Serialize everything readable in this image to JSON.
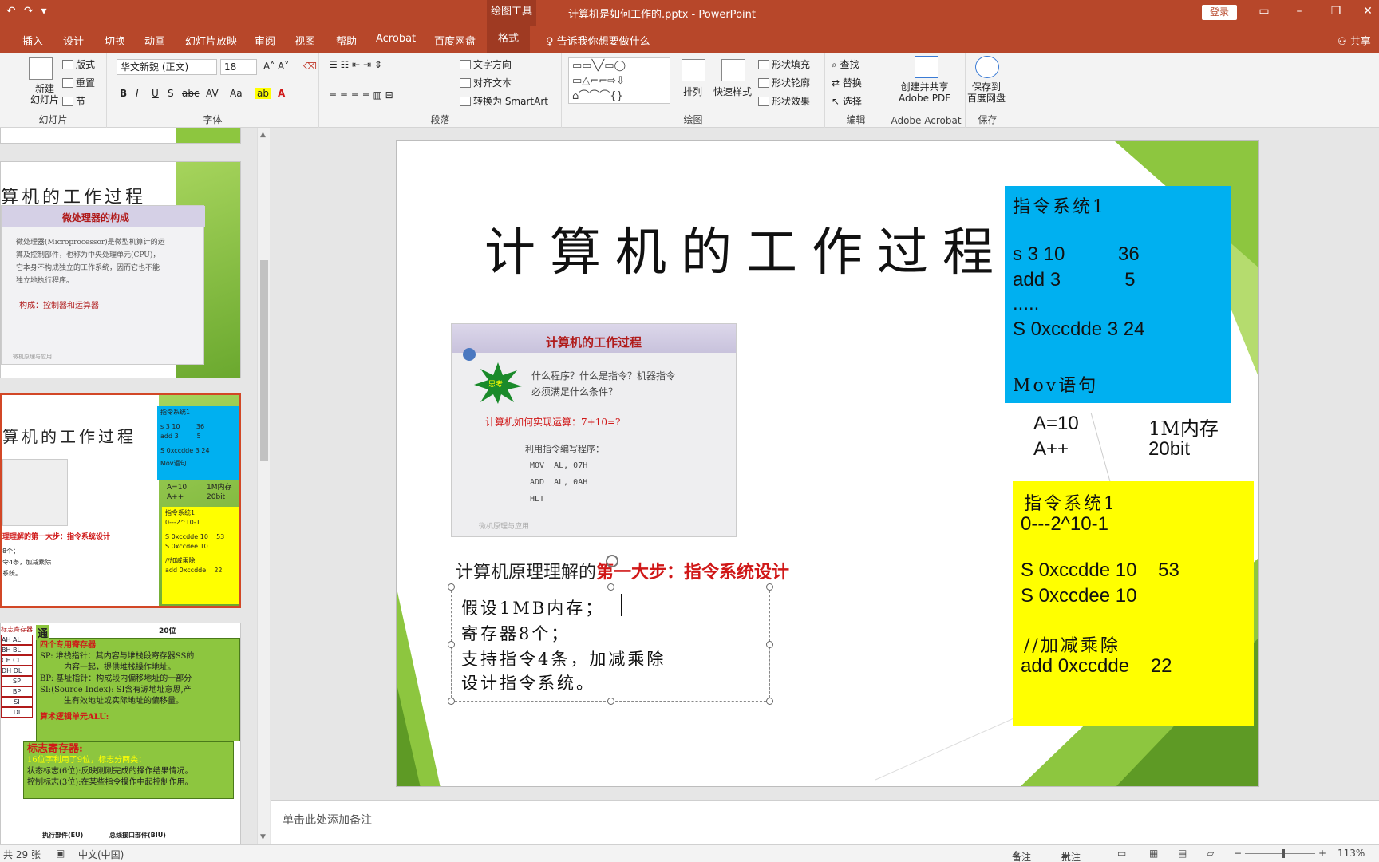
{
  "app": {
    "context_tools": "绘图工具",
    "document_title": "计算机是如何工作的.pptx - PowerPoint",
    "login_label": "登录"
  },
  "ribbon_tabs": [
    "插入",
    "设计",
    "切换",
    "动画",
    "幻灯片放映",
    "审阅",
    "视图",
    "帮助",
    "Acrobat",
    "百度网盘",
    "格式"
  ],
  "active_tab": "格式",
  "tell_me": "告诉我你想要做什么",
  "share_label": "共享",
  "ribbon": {
    "slides": {
      "label": "幻灯片",
      "new_slide": "新建\n幻灯片",
      "layout": "版式",
      "reset": "重置",
      "section": "节"
    },
    "font": {
      "label": "字体",
      "font_name": "华文新魏 (正文)",
      "font_size": "18",
      "buttons": [
        "B",
        "I",
        "U",
        "S",
        "abc",
        "AV",
        "Aa",
        "A"
      ]
    },
    "paragraph": {
      "label": "段落",
      "text_direction": "文字方向",
      "align_text": "对齐文本",
      "smartart": "转换为 SmartArt"
    },
    "drawing": {
      "label": "绘图",
      "arrange": "排列",
      "quick_styles": "快速样式",
      "shape_fill": "形状填充",
      "shape_outline": "形状轮廓",
      "shape_effects": "形状效果"
    },
    "editing": {
      "label": "编辑",
      "find": "查找",
      "replace": "替换",
      "select": "选择"
    },
    "acrobat": {
      "label": "Adobe Acrobat",
      "create_pdf": "创建并共享\nAdobe PDF"
    },
    "save": {
      "label": "保存",
      "save_to_baidu": "保存到\n百度网盘"
    }
  },
  "thumbnails": {
    "slide_a": {
      "title": "算机的工作过程",
      "embed_title": "微处理器的构成",
      "embed_text": [
        "微处理器(Microprocessor)是微型机算计的运",
        "算及控制部件，也称为中央处理单元(CPU)，",
        "它本身不构成独立的工作系统，因而它也不能",
        "独立地执行程序。"
      ],
      "composition": "构成：控制器和运算器",
      "footer": "微机原理与应用"
    },
    "slide_b": {
      "title": "算机的工作过程",
      "cyan_lines": [
        "指令系统1",
        "s 3 10        36",
        "add 3         5",
        "S 0xccdde 3  24",
        "Mov语句"
      ],
      "mid_lines": [
        "A=10",
        "A++",
        "1M内存",
        "20bit"
      ],
      "yellow_lines": [
        "指令系统1",
        "0---2^10-1",
        "S 0xccdde 10    53",
        "S 0xccdee 10",
        "//加减乘除",
        "add 0xccdde    22"
      ],
      "step": "理理解的第一大步：指令系统设计",
      "body": [
        "8个；",
        "令4条，加减乘除",
        "系统。"
      ]
    },
    "slide_c": {
      "heading1": "四个专用寄存器",
      "lines": [
        "SP: 堆栈指针：其内容与堆栈段寄存器SS的",
        "内容一起，提供堆栈操作地址。",
        "BP: 基址指针：构成段内偏移地址的一部分",
        "SI:(Source Index): SI含有源地址意思,产",
        "生有效地址或实际地址的偏移量。"
      ],
      "alu": "算术逻辑单元ALU:",
      "flags_title": "标志寄存器:",
      "flags_note": "16位字利用了9位，标志分两类：",
      "status_flag": "状态标志(6位):反映刚刚完成的操作结果情况。",
      "control_flag": "控制标志(3位):在某些指令操作中起控制作用。",
      "regs": [
        "AH AL",
        "BH BL",
        "CH CL",
        "DH DL",
        "SP",
        "BP",
        "SI",
        "DI"
      ],
      "eu": "执行部件(EU)",
      "biu": "总线接口部件(BIU)",
      "bits": "20位",
      "tong": "通",
      "flag_reg": "标志寄存器"
    }
  },
  "slide": {
    "title": "计算机的工作过程",
    "embedded": {
      "title": "计算机的工作过程",
      "badge": "思考",
      "question1": "什么程序？什么是指令？机器指令",
      "question2": "必须满足什么条件？",
      "question3": "计算机如何实现运算：7+10=?",
      "program_label": "利用指令编写程序：",
      "code": [
        "MOV  AL, 07H",
        "ADD  AL, 0AH",
        "HLT"
      ],
      "footer": "微机原理与应用"
    },
    "step_prefix": "计算机原理理解的",
    "step_highlight": "第一大步：指令系统设计",
    "body_lines": [
      "假设1MB内存；",
      "寄存器8个；",
      "支持指令4条，加减乘除",
      "设计指令系统。"
    ],
    "cyan_box": {
      "title": "指令系统1",
      "lines": [
        "s 3 10          36",
        "add 3            5",
        ".....",
        "S 0xccdde 3  24"
      ],
      "footer": "Mov语句"
    },
    "mid": {
      "a": "A=10",
      "b": "A++",
      "mem": "1M内存",
      "bits": "20bit"
    },
    "yellow_box": {
      "title": "指令系统1",
      "range": "0---2^10-1",
      "l1": "S 0xccdde 10    53",
      "l2": "S 0xccdee 10",
      "comment": "//加减乘除",
      "l3": "add 0xccdde    22"
    }
  },
  "notes_placeholder": "单击此处添加备注",
  "status": {
    "slide_count": "共 29 张",
    "language": "中文(中国)",
    "notes": "备注",
    "comments": "批注",
    "zoom": "113%"
  },
  "colors": {
    "accent": "#b7472a",
    "cyan": "#00b0f0",
    "yellow": "#ffff00",
    "green": "#8dc63f",
    "red": "#d01818"
  }
}
